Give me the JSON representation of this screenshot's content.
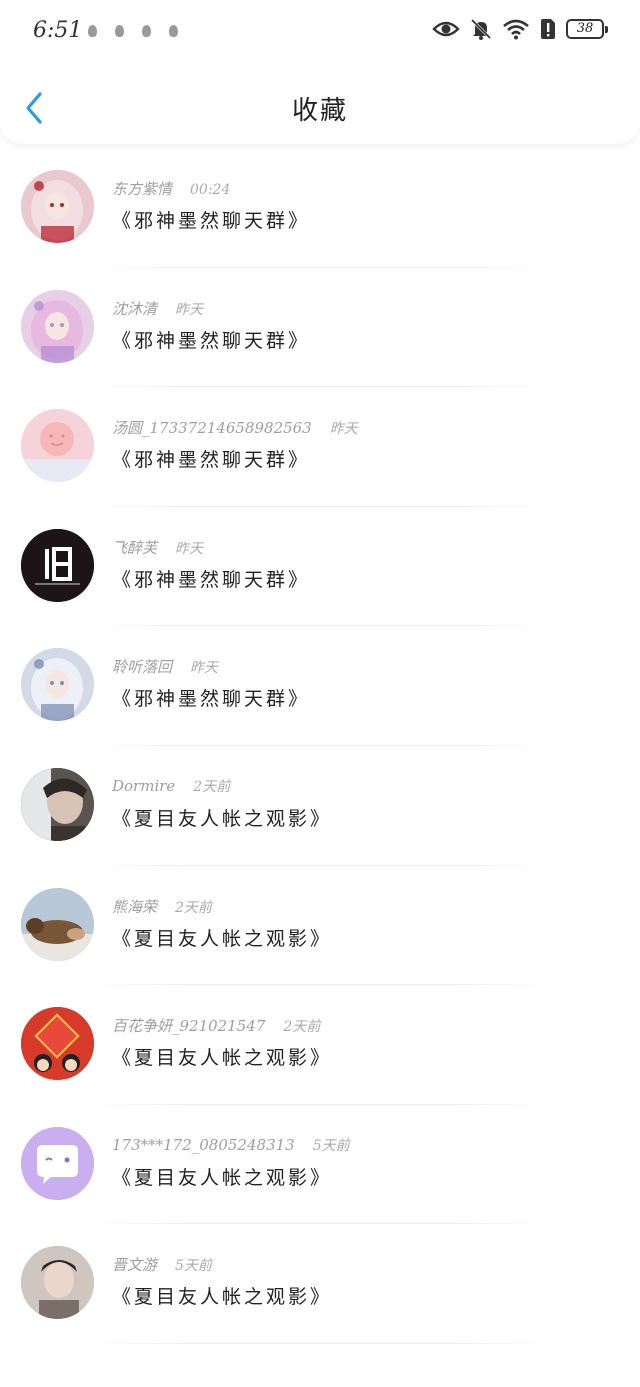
{
  "status_bar": {
    "time": "6:51",
    "battery": "38"
  },
  "header": {
    "title": "收藏"
  },
  "favorites": [
    {
      "user": "东方紫情",
      "time": "00:24",
      "title": "《邪神墨然聊天群》",
      "avatar": "anime-girl-red-avatar",
      "bg": "#e9c8cf"
    },
    {
      "user": "沈沐清",
      "time": "昨天",
      "title": "《邪神墨然聊天群》",
      "avatar": "anime-girl-pink-avatar",
      "bg": "#e7cfe6"
    },
    {
      "user": "汤圆_17337214658982563",
      "time": "昨天",
      "title": "《邪神墨然聊天群》",
      "avatar": "pink-sun-avatar",
      "bg": "#f5d3d8"
    },
    {
      "user": "飞醉芙",
      "time": "昨天",
      "title": "《邪神墨然聊天群》",
      "avatar": "black-18-avatar",
      "bg": "#1c1416",
      "avatar_text": "18"
    },
    {
      "user": "聆听落回",
      "time": "昨天",
      "title": "《邪神墨然聊天群》",
      "avatar": "anime-girl-blue-avatar",
      "bg": "#d4d9e6"
    },
    {
      "user": "Dormire",
      "time": "2天前",
      "title": "《夏目友人帐之观影》",
      "avatar": "anime-boy-dark-avatar",
      "bg": "#5a5450"
    },
    {
      "user": "熊海荣",
      "time": "2天前",
      "title": "《夏目友人帐之观影》",
      "avatar": "cat-avatar",
      "bg": "#b9c8d6"
    },
    {
      "user": "百花争妍_921021547",
      "time": "2天前",
      "title": "《夏目友人帐之观影》",
      "avatar": "fu-red-avatar",
      "bg": "#d83a2a",
      "avatar_text": "福"
    },
    {
      "user": "173***172_0805248313",
      "time": "5天前",
      "title": "《夏目友人帐之观影》",
      "avatar": "purple-chat-avatar",
      "bg": "#c9aef0"
    },
    {
      "user": "晋文游",
      "time": "5天前",
      "title": "《夏目友人帐之观影》",
      "avatar": "boy-photo-avatar",
      "bg": "#a89f97"
    }
  ]
}
